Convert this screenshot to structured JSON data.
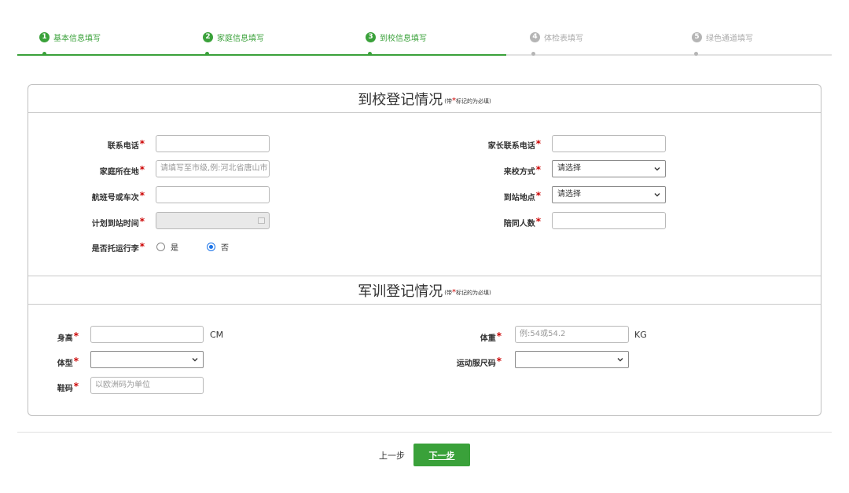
{
  "steps": [
    {
      "num": "1",
      "label": "基本信息填写",
      "state": "done"
    },
    {
      "num": "2",
      "label": "家庭信息填写",
      "state": "done"
    },
    {
      "num": "3",
      "label": "到校信息填写",
      "state": "done"
    },
    {
      "num": "4",
      "label": "体检表填写",
      "state": "todo"
    },
    {
      "num": "5",
      "label": "绿色通道填写",
      "state": "todo"
    }
  ],
  "arrival": {
    "title": "到校登记情况",
    "note_pre": "(带",
    "note_star": "*",
    "note_post": "标记的为必填)",
    "phone_label": "联系电话",
    "parent_phone_label": "家长联系电话",
    "home_label": "家庭所在地",
    "home_placeholder": "请填写至市级,例:河北省唐山市",
    "arrival_method_label": "来校方式",
    "arrival_method_value": "请选择",
    "flight_label": "航班号或车次",
    "station_label": "到站地点",
    "station_value": "请选择",
    "planned_time_label": "计划到站时间",
    "companions_label": "陪同人数",
    "luggage_label": "是否托运行李",
    "luggage_yes": "是",
    "luggage_no": "否"
  },
  "military": {
    "title": "军训登记情况",
    "note_pre": "(带",
    "note_star": "*",
    "note_post": "标记的为必填)",
    "height_label": "身高",
    "height_unit": "CM",
    "weight_label": "体重",
    "weight_placeholder": "例:54或54.2",
    "weight_unit": "KG",
    "body_type_label": "体型",
    "body_type_value": "",
    "sportswear_label": "运动服尺码",
    "sportswear_value": "",
    "shoe_label": "鞋码",
    "shoe_placeholder": "以欧洲码为单位"
  },
  "footer": {
    "prev_label": "上一步",
    "next_label": "下一步"
  },
  "colors": {
    "accent": "#3aa13a",
    "required": "#cc0000",
    "radio": "#1a73e8"
  }
}
